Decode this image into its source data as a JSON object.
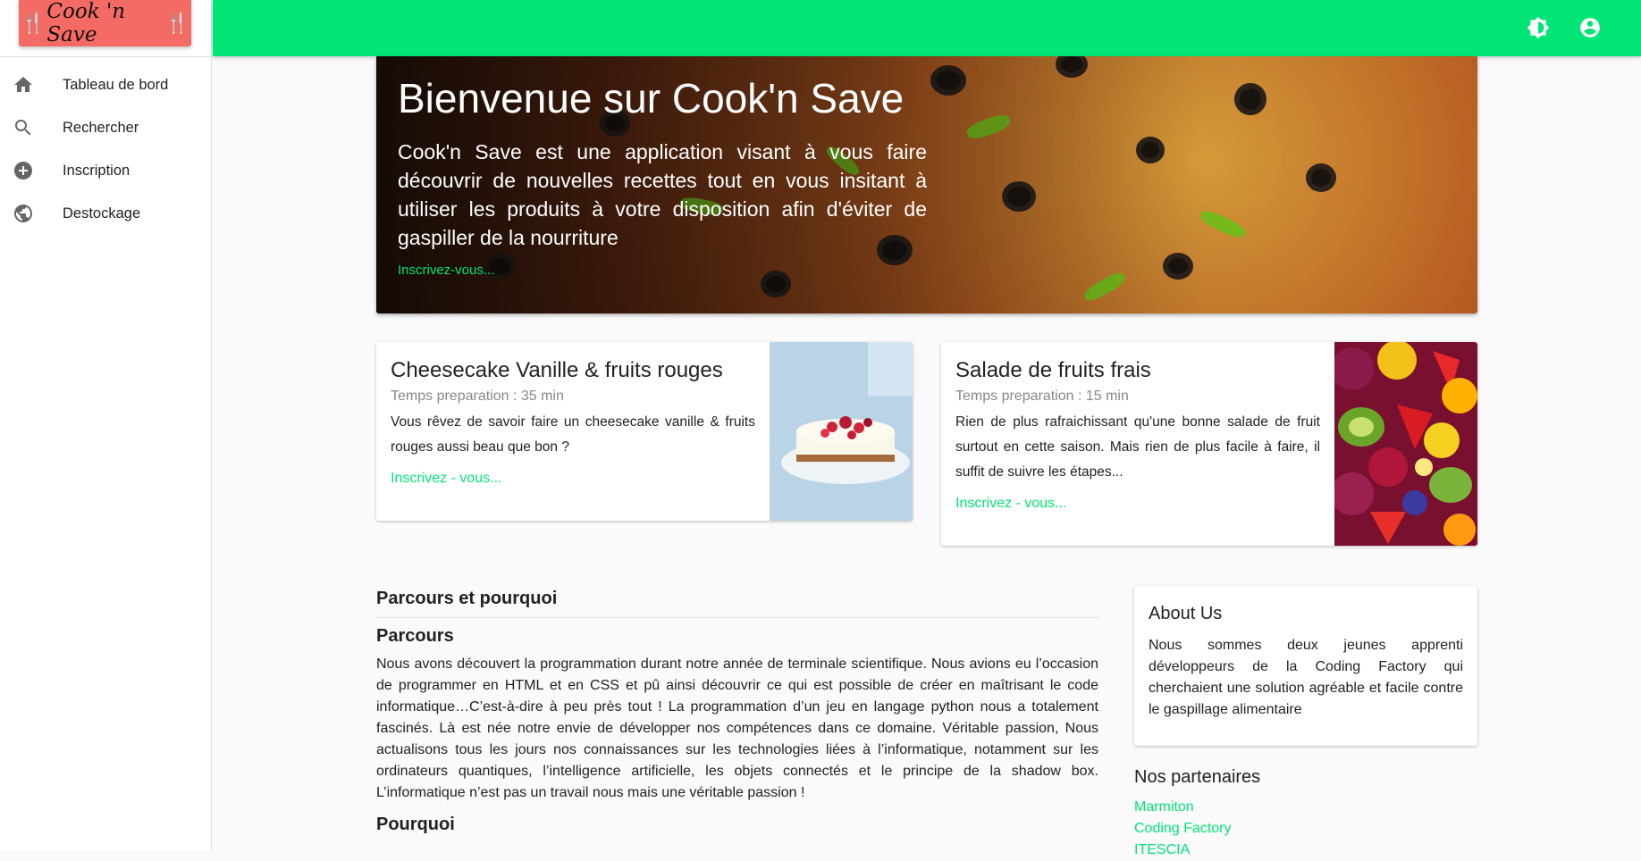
{
  "app": {
    "logo_text": "Cook 'n Save",
    "logo_utensil": "🍴"
  },
  "sidebar": {
    "items": [
      {
        "label": "Tableau de bord",
        "icon": "home-icon"
      },
      {
        "label": "Rechercher",
        "icon": "search-icon"
      },
      {
        "label": "Inscription",
        "icon": "add-circle-icon"
      },
      {
        "label": "Destockage",
        "icon": "globe-icon"
      }
    ]
  },
  "topbar": {
    "theme_icon": "brightness-icon",
    "account_icon": "account-circle-icon",
    "color": "#00e575"
  },
  "hero": {
    "title": "Bienvenue sur Cook'n Save",
    "body": "Cook'n Save est une application visant à vous faire découvrir de nouvelles recettes tout en vous insitant à utiliser les produits à votre disposition afin d'éviter de gaspiller de la nourriture",
    "link": "Inscrivez-vous..."
  },
  "cards": [
    {
      "title": "Cheesecake Vanille & fruits rouges",
      "subtitle": "Temps preparation : 35 min",
      "text": "Vous rêvez de savoir faire un cheesecake vanille & fruits rouges aussi beau que bon ?",
      "link": "Inscrivez - vous..."
    },
    {
      "title": "Salade de fruits frais",
      "subtitle": "Temps preparation : 15 min",
      "text": "Rien de plus rafraichissant qu'une bonne salade de fruit surtout en cette saison. Mais rien de plus facile à faire, il suffit de suivre les étapes...",
      "link": "Inscrivez - vous..."
    }
  ],
  "content": {
    "heading": "Parcours et pourquoi",
    "parcours_title": "Parcours",
    "parcours_text": "Nous avons découvert la programmation durant notre année de terminale scientifique. Nous avions eu l’occasion de programmer en HTML et en CSS et pû ainsi découvrir ce qui est possible de créer en maîtrisant le code informatique…C’est-à-dire à peu près tout ! La programmation d’un jeu en langage python nous a totalement fascinés. Là est née notre envie de développer nos compétences dans ce domaine. Véritable passion, Nous actualisons tous les jours nos connaissances sur les technologies liées à l’informatique, notamment sur les ordinateurs quantiques, l’intelligence artificielle, les objets connectés et le principe de la shadow box. L’informatique n’est pas un travail nous mais une véritable passion !",
    "pourquoi_title": "Pourquoi"
  },
  "about": {
    "title": "About Us",
    "text": "Nous sommes deux jeunes apprenti développeurs de la Coding Factory qui cherchaient une solution agréable et facile contre le gaspillage alimentaire"
  },
  "partners": {
    "title": "Nos partenaires",
    "links": [
      "Marmiton",
      "Coding Factory",
      "ITESCIA"
    ]
  }
}
